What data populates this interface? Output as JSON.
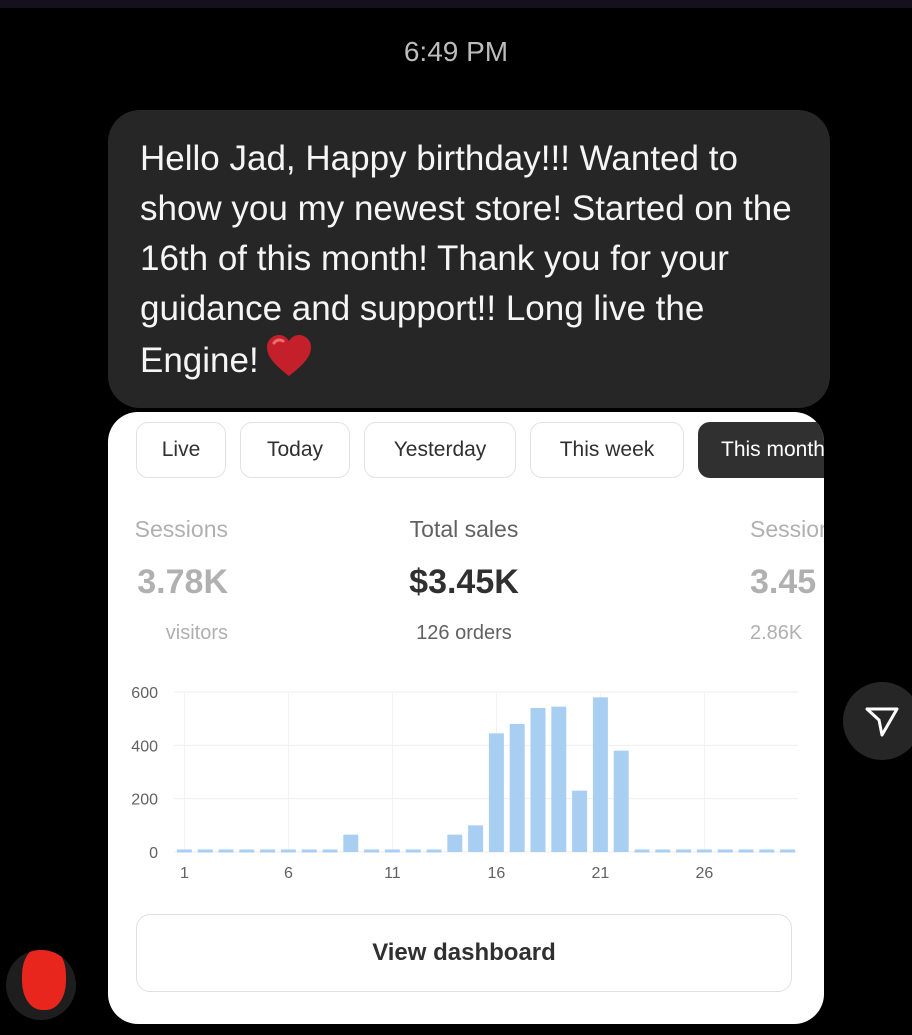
{
  "message": {
    "timestamp": "6:49 PM",
    "text": "Hello Jad, Happy birthday!!! Wanted to show you my newest store! Started on the 16th of this month! Thank you for your guidance and support!! Long live the Engine!",
    "reaction_icon": "red-heart-emoji"
  },
  "card": {
    "tabs": [
      {
        "label": "Live"
      },
      {
        "label": "Today"
      },
      {
        "label": "Yesterday"
      },
      {
        "label": "This week"
      },
      {
        "label": "This month",
        "active": true
      }
    ],
    "metrics": [
      {
        "label": "Sessions",
        "value": "3.78K",
        "sub": "visitors"
      },
      {
        "label": "Total sales",
        "value": "$3.45K",
        "sub": "126 orders"
      },
      {
        "label": "Sessions",
        "value": "3.45",
        "sub": "2.86K"
      }
    ],
    "view_dashboard_label": "View dashboard"
  },
  "chart_data": {
    "type": "bar",
    "x": [
      1,
      2,
      3,
      4,
      5,
      6,
      7,
      8,
      9,
      10,
      11,
      12,
      13,
      14,
      15,
      16,
      17,
      18,
      19,
      20,
      21,
      22,
      23,
      24,
      25,
      26,
      27,
      28,
      29,
      30
    ],
    "values": [
      0,
      0,
      0,
      0,
      0,
      0,
      0,
      0,
      65,
      0,
      0,
      0,
      0,
      65,
      100,
      445,
      480,
      540,
      545,
      230,
      580,
      380,
      0,
      0,
      0,
      0,
      0,
      0,
      0,
      0
    ],
    "x_tick_labels": [
      "1",
      "6",
      "11",
      "16",
      "21",
      "26"
    ],
    "y_tick_labels": [
      "0",
      "200",
      "400",
      "600"
    ],
    "ylim": [
      0,
      600
    ],
    "grid": true,
    "bar_color": "#a8cff2",
    "zero_dash_color": "#a8cff2"
  },
  "colors": {
    "background": "#000000",
    "bubble": "#262626",
    "card": "#ffffff",
    "active_tab": "#303030"
  },
  "icons": {
    "share": "send-arrow-icon",
    "reaction": "red-heart-emoji"
  }
}
